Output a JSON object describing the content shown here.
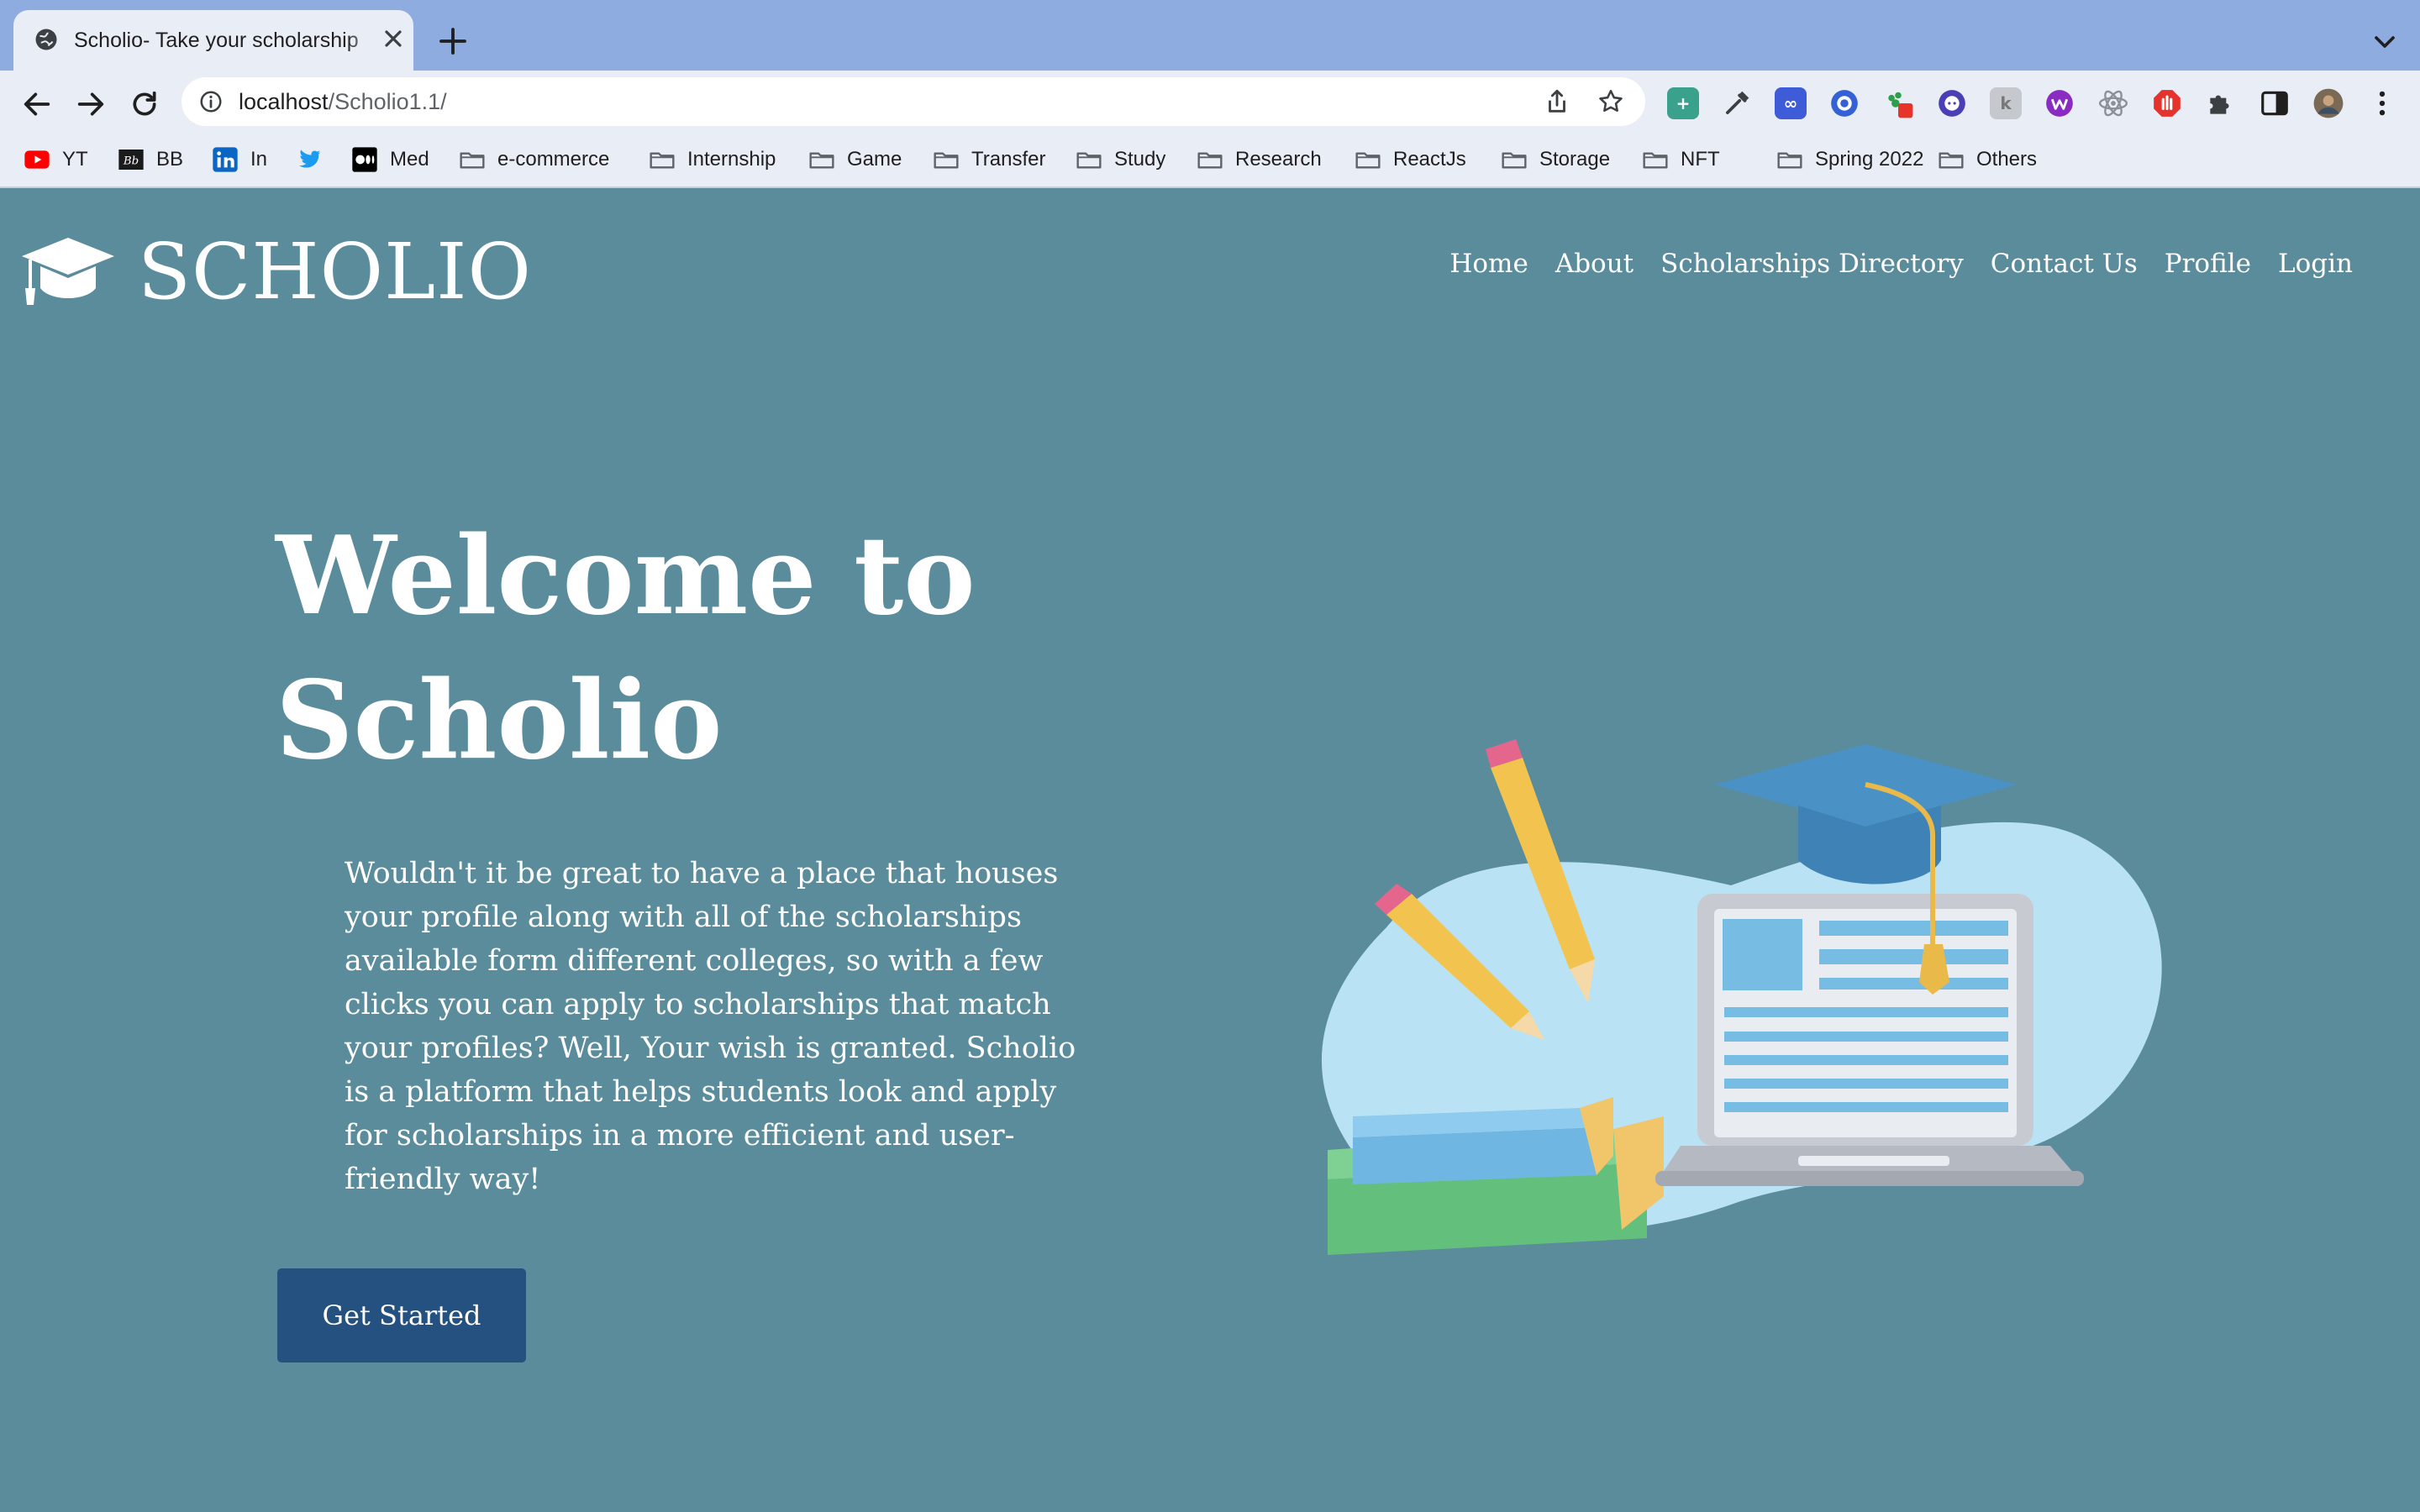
{
  "browser": {
    "tab": {
      "title": "Scholio- Take your scholarship"
    },
    "address_bar": {
      "host": "localhost",
      "path": "/Scholio1.1/"
    },
    "bookmarks": [
      {
        "label": "YT",
        "icon": "youtube-icon"
      },
      {
        "label": "BB",
        "icon": "blackboard-icon"
      },
      {
        "label": "In",
        "icon": "linkedin-icon"
      },
      {
        "label": "",
        "icon": "twitter-icon"
      },
      {
        "label": "Med",
        "icon": "medium-icon"
      },
      {
        "label": "e-commerce",
        "icon": "folder-icon"
      },
      {
        "label": "Internship",
        "icon": "folder-icon"
      },
      {
        "label": "Game",
        "icon": "folder-icon"
      },
      {
        "label": "Transfer",
        "icon": "folder-icon"
      },
      {
        "label": "Study",
        "icon": "folder-icon"
      },
      {
        "label": "Research",
        "icon": "folder-icon"
      },
      {
        "label": "ReactJs",
        "icon": "folder-icon"
      },
      {
        "label": "Storage",
        "icon": "folder-icon"
      },
      {
        "label": "NFT",
        "icon": "folder-icon"
      },
      {
        "label": "Spring 2022",
        "icon": "folder-icon"
      },
      {
        "label": "Others",
        "icon": "folder-icon"
      }
    ],
    "colors": {
      "tabstrip": "#8eacdf",
      "toolbar": "#e9eef6"
    }
  },
  "site": {
    "logo_text": "SCHOLIO",
    "nav": [
      "Home",
      "About",
      "Scholarships Directory",
      "Contact Us",
      "Profile",
      "Login"
    ],
    "hero": {
      "title": "Welcome to Scholio",
      "text": "Wouldn't it be great to have a place that houses your profile along with all of the scholarships available form different colleges, so with a few clicks you can apply to scholarships that match your profiles? Well, Your wish is granted. Scholio is a platform that helps students look and apply for scholarships in a more efficient and user-friendly way!",
      "cta": "Get Started"
    },
    "colors": {
      "background": "#5a8c9c",
      "button": "#245180",
      "text": "#ffffff"
    }
  }
}
